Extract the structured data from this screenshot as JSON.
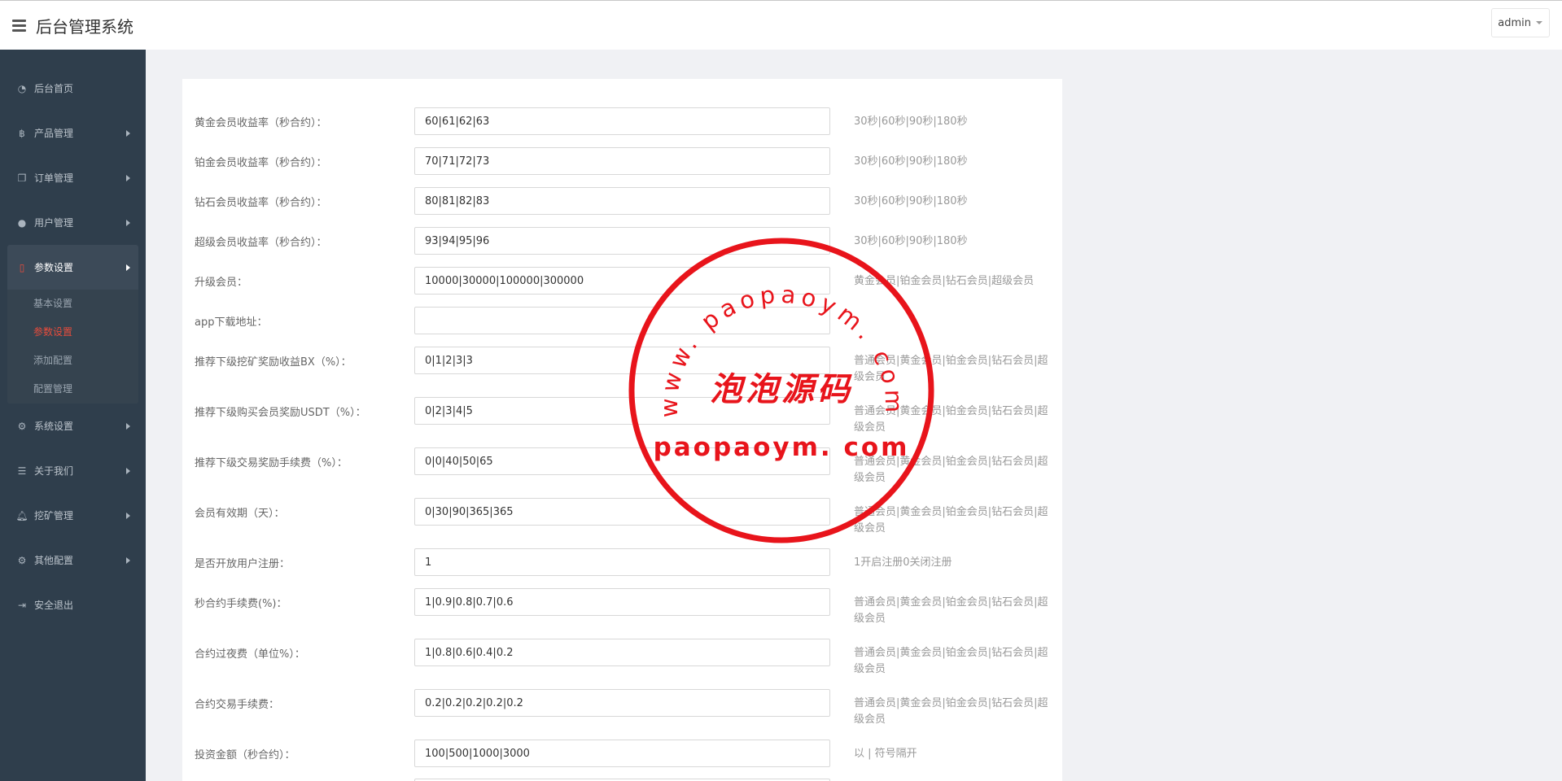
{
  "header": {
    "title": "后台管理系统",
    "user": "admin"
  },
  "sidebar": {
    "items": [
      {
        "label": "后台首页",
        "icon": "dashboard-icon"
      },
      {
        "label": "产品管理",
        "icon": "bitcoin-icon"
      },
      {
        "label": "订单管理",
        "icon": "copy-icon"
      },
      {
        "label": "用户管理",
        "icon": "user-icon"
      },
      {
        "label": "参数设置",
        "icon": "file-icon"
      },
      {
        "label": "系统设置",
        "icon": "gears-icon"
      },
      {
        "label": "关于我们",
        "icon": "list-icon"
      },
      {
        "label": "挖矿管理",
        "icon": "bell-icon"
      },
      {
        "label": "其他配置",
        "icon": "gear-icon"
      },
      {
        "label": "安全退出",
        "icon": "logout-icon"
      }
    ],
    "subitems": [
      "基本设置",
      "参数设置",
      "添加配置",
      "配置管理"
    ]
  },
  "form": {
    "rows": [
      {
        "label": "黄金会员收益率（秒合约）：",
        "value": "60|61|62|63",
        "hint": "30秒|60秒|90秒|180秒"
      },
      {
        "label": "铂金会员收益率（秒合约）：",
        "value": "70|71|72|73",
        "hint": "30秒|60秒|90秒|180秒"
      },
      {
        "label": "钻石会员收益率（秒合约）：",
        "value": "80|81|82|83",
        "hint": "30秒|60秒|90秒|180秒"
      },
      {
        "label": "超级会员收益率（秒合约）：",
        "value": "93|94|95|96",
        "hint": "30秒|60秒|90秒|180秒"
      },
      {
        "label": "升级会员：",
        "value": "10000|30000|100000|300000",
        "hint": "黄金会员|铂金会员|钻石会员|超级会员"
      },
      {
        "label": "app下载地址：",
        "value": "",
        "hint": ""
      },
      {
        "label": "推荐下级挖矿奖励收益BX（%）：",
        "value": "0|1|2|3|3",
        "hint": "普通会员|黄金会员|铂金会员|钻石会员|超级会员"
      },
      {
        "label": "推荐下级购买会员奖励USDT（%）：",
        "value": "0|2|3|4|5",
        "hint": "普通会员|黄金会员|铂金会员|钻石会员|超级会员"
      },
      {
        "label": "推荐下级交易奖励手续费（%）：",
        "value": "0|0|40|50|65",
        "hint": "普通会员|黄金会员|铂金会员|钻石会员|超级会员"
      },
      {
        "label": "会员有效期（天）：",
        "value": "0|30|90|365|365",
        "hint": "普通会员|黄金会员|铂金会员|钻石会员|超级会员"
      },
      {
        "label": "是否开放用户注册：",
        "value": "1",
        "hint": "1开启注册0关闭注册"
      },
      {
        "label": "秒合约手续费(%)：",
        "value": "1|0.9|0.8|0.7|0.6",
        "hint": "普通会员|黄金会员|铂金会员|钻石会员|超级会员"
      },
      {
        "label": "合约过夜费（单位%）：",
        "value": "1|0.8|0.6|0.4|0.2",
        "hint": "普通会员|黄金会员|铂金会员|钻石会员|超级会员"
      },
      {
        "label": "合约交易手续费：",
        "value": "0.2|0.2|0.2|0.2|0.2",
        "hint": "普通会员|黄金会员|铂金会员|钻石会员|超级会员"
      },
      {
        "label": "投资金额（秒合约）：",
        "value": "100|500|1000|3000",
        "hint": "以 | 符号隔开"
      }
    ]
  },
  "watermark": {
    "ring_text": "www. paopaoym. com",
    "center_text": "泡泡源码",
    "bottom_text": "paopaoym. com",
    "color": "#e8141b"
  }
}
